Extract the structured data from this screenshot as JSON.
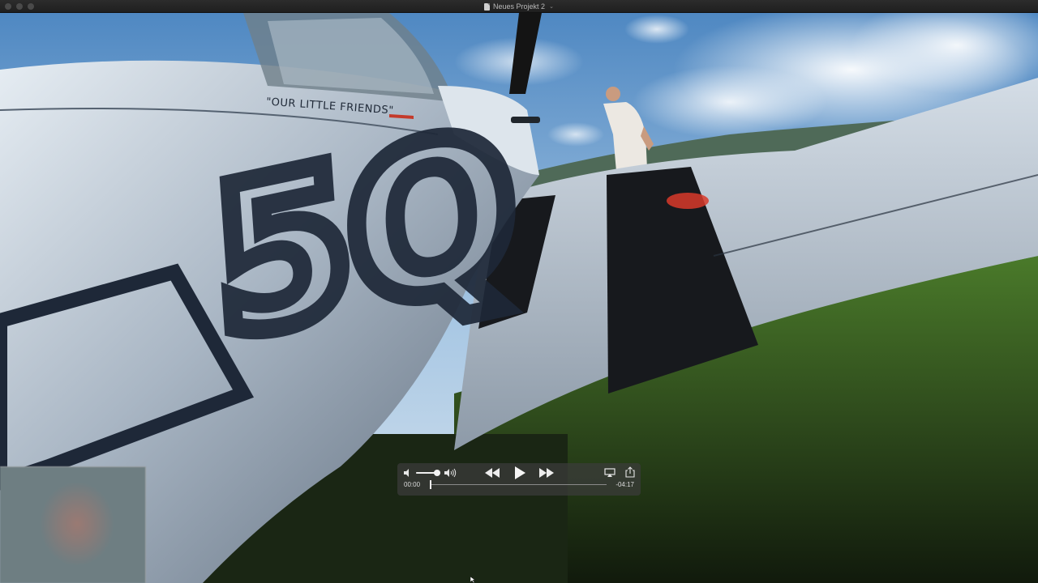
{
  "window": {
    "title": "Neues Projekt 2",
    "icons": {
      "document": "document-icon",
      "title_menu": "chevron-down-icon"
    },
    "title_menu_glyph": "⌄"
  },
  "video": {
    "fuselage_lettering": "\"OUR LITTLE FRIENDS\"",
    "fuselage_number": "5Q",
    "colors": {
      "sky": "#a9c8e4",
      "grass": "#2e4a1c",
      "aircraft": "#c9d4df",
      "invasion_stripe": "#17191d",
      "marking": "#1e2838"
    }
  },
  "controls": {
    "volume": 0.85,
    "position": 0.0,
    "elapsed": "00:00",
    "remaining": "-04:17",
    "icons": {
      "volume_low": "volume-low-icon",
      "volume_high": "volume-high-icon",
      "rewind": "rewind-icon",
      "play": "play-icon",
      "fast_forward": "fast-forward-icon",
      "airplay": "airplay-icon",
      "share": "share-icon"
    }
  }
}
